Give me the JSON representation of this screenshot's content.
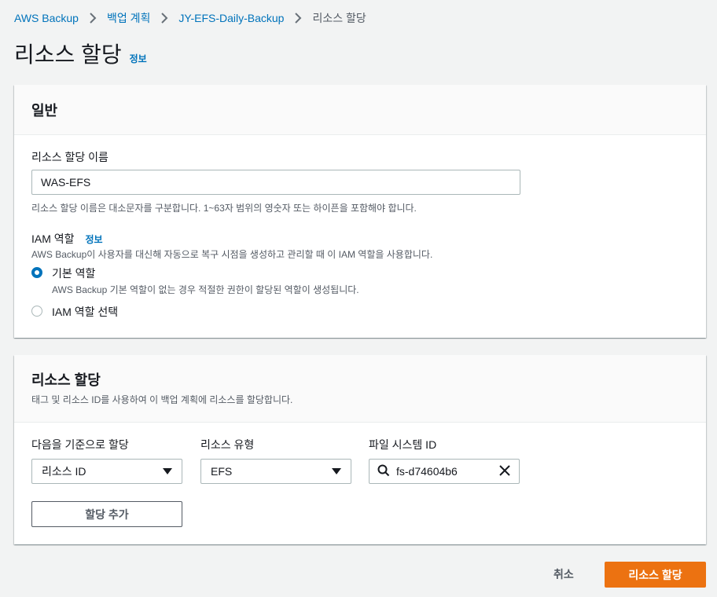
{
  "breadcrumb": {
    "items": [
      "AWS Backup",
      "백업 계획",
      "JY-EFS-Daily-Backup",
      "리소스 할당"
    ]
  },
  "page": {
    "title": "리소스 할당",
    "info_label": "정보"
  },
  "general": {
    "title": "일반",
    "name_label": "리소스 할당 이름",
    "name_value": "WAS-EFS",
    "name_hint": "리소스 할당 이름은 대소문자를 구분합니다. 1~63자 범위의 영숫자 또는 하이픈을 포함해야 합니다.",
    "iam_label": "IAM 역할",
    "iam_info": "정보",
    "iam_desc": "AWS Backup이 사용자를 대신해 자동으로 복구 시점을 생성하고 관리할 때 이 IAM 역할을 사용합니다.",
    "default_role_label": "기본 역할",
    "default_role_desc": "AWS Backup 기본 역할이 없는 경우 적절한 권한이 할당된 역할이 생성됩니다.",
    "choose_role_label": "IAM 역할 선택"
  },
  "assign": {
    "title": "리소스 할당",
    "desc": "태그 및 리소스 ID를 사용하여 이 백업 계획에 리소스를 할당합니다.",
    "col_assign_by": "다음을 기준으로 할당",
    "col_resource_type": "리소스 유형",
    "col_filesystem_id": "파일 시스템 ID",
    "assign_by_value": "리소스 ID",
    "resource_type_value": "EFS",
    "filesystem_id_value": "fs-d74604b6",
    "add_button": "할당 추가"
  },
  "footer": {
    "cancel": "취소",
    "submit": "리소스 할당"
  },
  "colors": {
    "link": "#0073bb",
    "primary": "#ec7211",
    "radio_checked": "#0073bb"
  }
}
